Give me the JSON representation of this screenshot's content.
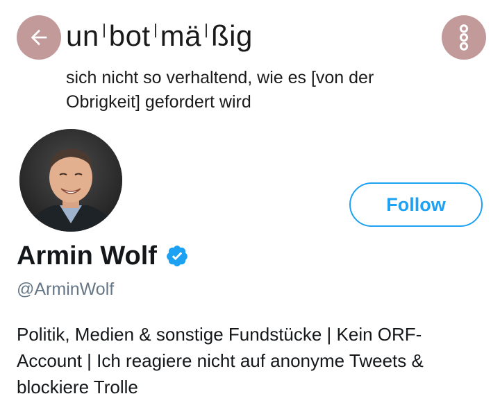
{
  "banner": {
    "syllables": [
      "un",
      "bot",
      "mä",
      "ßig"
    ],
    "definition": "sich nicht so verhaltend, wie es [von der Obrigkeit] gefordert wird"
  },
  "nav": {
    "back_icon": "arrow-left-icon",
    "more_icon": "more-vertical-icon",
    "button_color": "#c29a9a"
  },
  "profile": {
    "display_name": "Armin Wolf",
    "verified": true,
    "handle": "@ArminWolf",
    "bio": "Politik, Medien & sonstige Fundstücke | Kein ORF-Account | Ich reagiere nicht auf anonyme Tweets & blockiere Trolle",
    "follow_label": "Follow",
    "accent_color": "#1da1f2",
    "handle_color": "#657786"
  }
}
